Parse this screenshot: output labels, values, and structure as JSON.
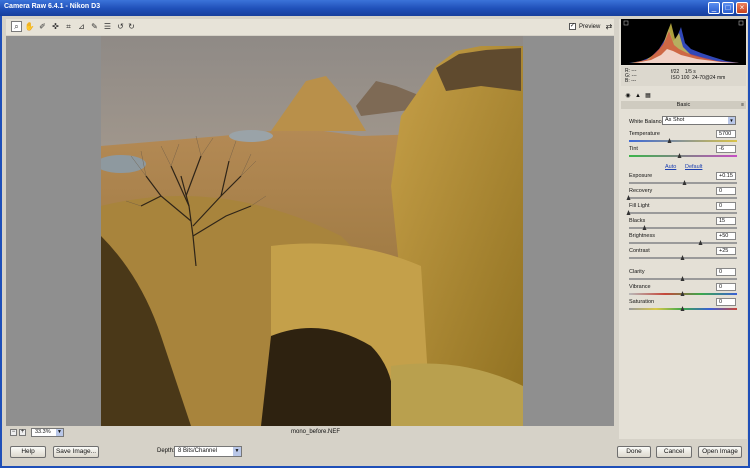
{
  "window": {
    "title": "Camera Raw 6.4.1  -  Nikon D3"
  },
  "toolbar": {
    "tools": [
      {
        "icon": "zoom-icon",
        "glyph": "🔍"
      },
      {
        "icon": "hand-icon",
        "glyph": "✋"
      },
      {
        "icon": "white-balance-icon",
        "glyph": "✐"
      },
      {
        "icon": "color-sampler-icon",
        "glyph": "✜"
      },
      {
        "icon": "crop-icon",
        "glyph": "⌗"
      },
      {
        "icon": "straighten-icon",
        "glyph": "⊿"
      },
      {
        "icon": "retouch-icon",
        "glyph": "✎"
      },
      {
        "icon": "preferences-icon",
        "glyph": "☰"
      },
      {
        "icon": "rotate-left-icon",
        "glyph": "↺"
      },
      {
        "icon": "rotate-right-icon",
        "glyph": "↻"
      }
    ],
    "preview_label": "Preview",
    "preview_checked": true
  },
  "status": {
    "zoom": "33.3%",
    "filename": "mono_before.NEF"
  },
  "footer": {
    "help_label": "Help",
    "save_label": "Save Image...",
    "depth_label": "Depth:",
    "depth_value": "8 Bits/Channel",
    "done_label": "Done",
    "cancel_label": "Cancel",
    "open_label": "Open Image"
  },
  "readout": {
    "r": "R:   ---",
    "g": "G:   ---",
    "b": "B:   ---",
    "aperture": "f/22",
    "shutter": "1/5 s",
    "iso": "ISO 100",
    "lens": "24-70@24 mm"
  },
  "panel": {
    "section_title": "Basic",
    "white_balance_label": "White Balance:",
    "white_balance_value": "As Shot",
    "auto_label": "Auto",
    "default_label": "Default",
    "sliders": {
      "temperature": {
        "label": "Temperature",
        "value": "5700",
        "fraction": 0.38
      },
      "tint": {
        "label": "Tint",
        "value": "-6",
        "fraction": 0.47
      },
      "exposure": {
        "label": "Exposure",
        "value": "+0.15",
        "fraction": 0.52
      },
      "recovery": {
        "label": "Recovery",
        "value": "0",
        "fraction": 0.0
      },
      "fill_light": {
        "label": "Fill Light",
        "value": "0",
        "fraction": 0.0
      },
      "blacks": {
        "label": "Blacks",
        "value": "15",
        "fraction": 0.15
      },
      "brightness": {
        "label": "Brightness",
        "value": "+50",
        "fraction": 0.67
      },
      "contrast": {
        "label": "Contrast",
        "value": "+25",
        "fraction": 0.5
      },
      "clarity": {
        "label": "Clarity",
        "value": "0",
        "fraction": 0.5
      },
      "vibrance": {
        "label": "Vibrance",
        "value": "0",
        "fraction": 0.5
      },
      "saturation": {
        "label": "Saturation",
        "value": "0",
        "fraction": 0.5
      }
    }
  },
  "colors": {
    "accent": "#1f4fb8",
    "canvas": "#8f8f8f",
    "panel": "#e4e0d6"
  }
}
